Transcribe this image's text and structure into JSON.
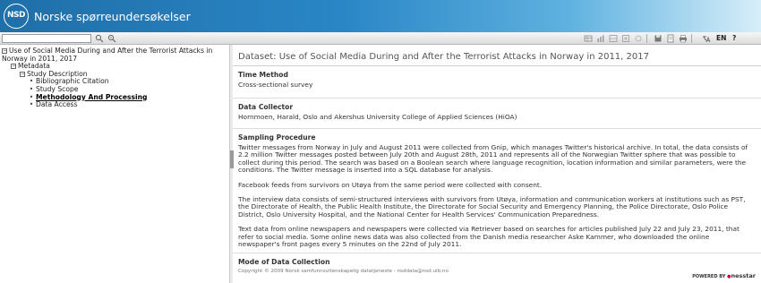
{
  "header": {
    "logo_text": "NSD",
    "title": "Norske spørreundersøkelser"
  },
  "toolbar": {
    "search_placeholder": "",
    "language": "EN",
    "help": "?",
    "icons": [
      "search-icon",
      "search-advanced-icon",
      "table-icon",
      "chart-icon",
      "tabulate-icon",
      "print-icon",
      "save-icon",
      "settings-icon",
      "bookmark-icon",
      "language-icon"
    ]
  },
  "sidebar": {
    "root": "Use of Social Media During and After the Terrorist Attacks in Norway in 2011, 2017",
    "metadata": "Metadata",
    "study_description": "Study Description",
    "items": [
      "Bibliographic Citation",
      "Study Scope",
      "Methodology And Processing"
    ],
    "data_access": "Data Access"
  },
  "main": {
    "title": "Dataset: Use of Social Media During and After the Terrorist Attacks in Norway in 2011, 2017",
    "time_method_label": "Time Method",
    "time_method_value": "Cross-sectional survey",
    "data_collector_label": "Data Collector",
    "data_collector_value": "Hornmoen, Harald, Oslo and Akershus University College of Applied Sciences  (HiOA)",
    "sampling_label": "Sampling Procedure",
    "sampling_p1": "Twitter messages from Norway in July and August 2011 were collected from Gnip, which manages Twitter's historical archive. In total, the data consists of 2.2 million Twitter messages posted between July 20th and August 28th, 2011 and represents all of the Norwegian Twitter sphere that was possible to collect during this period. The search was based on a Boolean search where language recognition, location information and similar parameters, were the conditions. The Twitter message is inserted into a SQL database for analysis.",
    "sampling_p2": "Facebook feeds from survivors on Utøya from the same period were collected with consent.",
    "sampling_p3": "The interview data consists of semi-structured interviews with survivors from Utøya, information and communication workers at institutions such as PST, the Directorate of Health, the Public Health Institute, the Directorate for Social Security and Emergency Planning, the Police Directorate, Oslo Police District, Oslo University Hospital, and the National Center for Health Services' Communication Preparedness.",
    "sampling_p4": "Text data from online newspapers and newspapers were collected via Retriever based on searches for articles published July 22 and July 23, 2011, that refer to social media. Some online news data was also collected from the Danish media researcher Aske Kammer, who downloaded the online newspaper's front pages every 5 minutes on the 22nd of July 2011.",
    "mode_label": "Mode of Data Collection"
  },
  "footer": {
    "copyright": "Copyright © 2009 Norsk samfunnsvitenskapelig datatjeneste - nsddata@nsd.uib.no",
    "powered_prefix": "POWERED BY",
    "powered_brand": "nesstar"
  },
  "colors": {
    "header_start": "#1f6fa8",
    "header_end": "#d8eef9"
  }
}
